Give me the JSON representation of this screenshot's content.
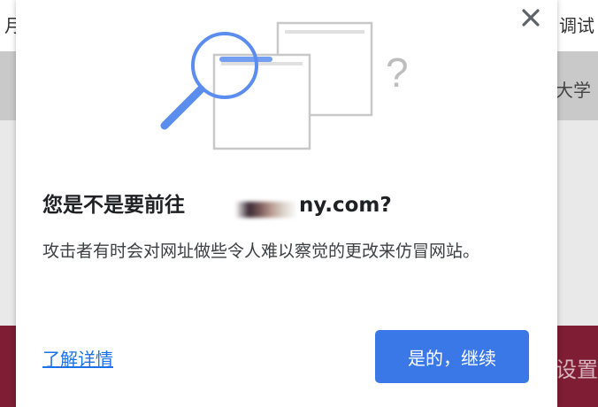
{
  "background": {
    "top_left_char": "月",
    "top_right_text": "调试",
    "mid_right_text": "大学",
    "bottom_right_text": "设置"
  },
  "dialog": {
    "title_prefix": "您是不是要前往",
    "title_suffix": "ny.com?",
    "description": "攻击者有时会对网址做些令人难以察觉的更改来仿冒网站。",
    "learn_more": "了解详情",
    "continue": "是的，继续",
    "question_mark": "?",
    "close_icon": "close-icon",
    "colors": {
      "accent": "#3b78e7",
      "link": "#1a73e8",
      "illustration_blue": "#5b8def"
    }
  }
}
